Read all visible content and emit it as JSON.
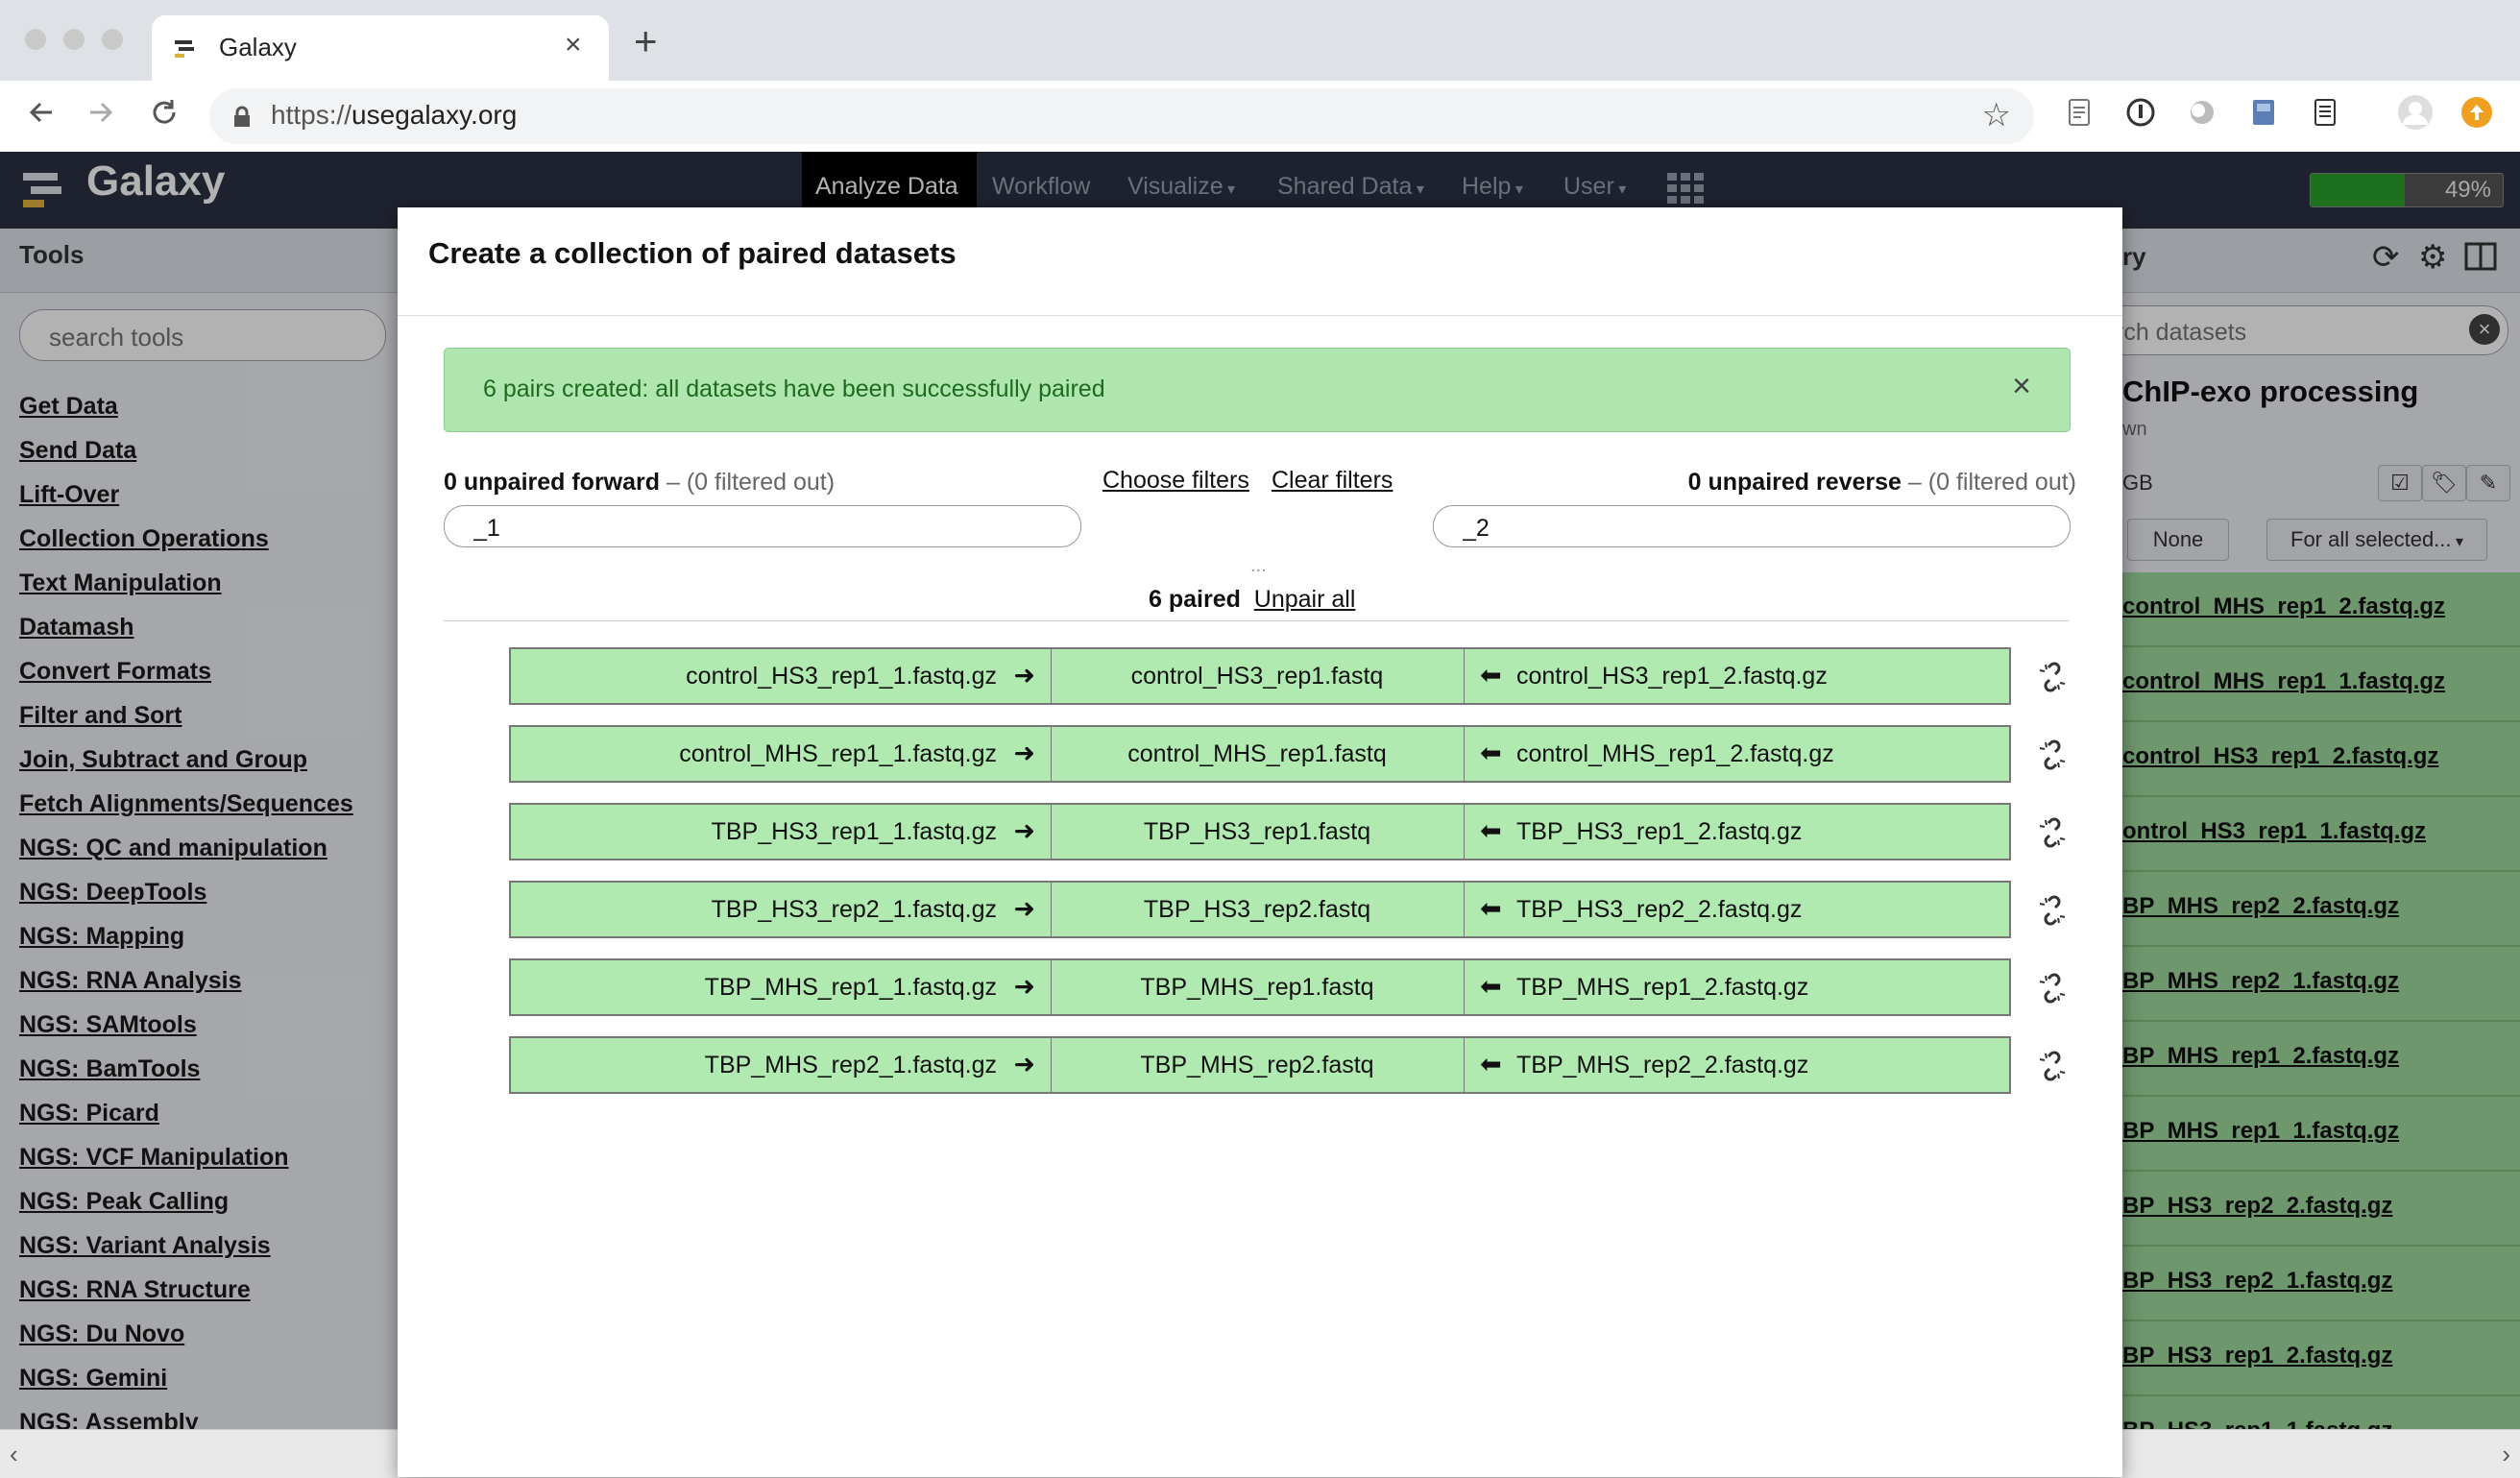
{
  "browser": {
    "tab_title": "Galaxy",
    "tab_close": "×",
    "new_tab": "+",
    "url_scheme": "https://",
    "url_host": "usegalaxy.org",
    "icons": [
      "back-icon",
      "forward-icon",
      "reload-icon",
      "lock-icon",
      "star-icon",
      "extension-icon",
      "profile-icon",
      "update-icon"
    ]
  },
  "masthead": {
    "brand": "Galaxy",
    "nav": [
      "Analyze Data",
      "Workflow",
      "Visualize",
      "Shared Data",
      "Help",
      "User"
    ],
    "active": "Analyze Data",
    "usage_label": "49%",
    "usage_fraction": 0.49
  },
  "tools": {
    "title": "Tools",
    "search_placeholder": "search tools",
    "sections": [
      "Get Data",
      "Send Data",
      "Lift-Over",
      "Collection Operations",
      "Text Manipulation",
      "Datamash",
      "Convert Formats",
      "Filter and Sort",
      "Join, Subtract and Group",
      "Fetch Alignments/Sequences",
      "NGS: QC and manipulation",
      "NGS: DeepTools",
      "NGS: Mapping",
      "NGS: RNA Analysis",
      "NGS: SAMtools",
      "NGS: BamTools",
      "NGS: Picard",
      "NGS: VCF Manipulation",
      "NGS: Peak Calling",
      "NGS: Variant Analysis",
      "NGS: RNA Structure",
      "NGS: Du Novo",
      "NGS: Gemini",
      "NGS: Assembly"
    ]
  },
  "history": {
    "title": "ry",
    "search_placeholder": "rch datasets",
    "name": "ChIP-exo processing",
    "sub": "wn",
    "size": "GB",
    "none_btn": "None",
    "for_all_btn": "For all selected...",
    "datasets": [
      "control_MHS_rep1_2.fastq.gz",
      "control_MHS_rep1_1.fastq.gz",
      "control_HS3_rep1_2.fastq.gz",
      "ontrol_HS3_rep1_1.fastq.gz",
      "BP_MHS_rep2_2.fastq.gz",
      "BP_MHS_rep2_1.fastq.gz",
      "BP_MHS_rep1_2.fastq.gz",
      "BP_MHS_rep1_1.fastq.gz",
      "BP_HS3_rep2_2.fastq.gz",
      "BP_HS3_rep2_1.fastq.gz",
      "BP_HS3_rep1_2.fastq.gz",
      "BP_HS3_rep1_1.fastq.gz"
    ]
  },
  "modal": {
    "title": "Create a collection of paired datasets",
    "alert": "6 pairs created: all datasets have been successfully paired",
    "alert_close": "×",
    "forward": {
      "count_label": "0 unpaired forward",
      "filtered": " – (0 filtered out)",
      "filter_value": "_1"
    },
    "reverse": {
      "count_label": "0 unpaired reverse",
      "filtered": " – (0 filtered out)",
      "filter_value": "_2"
    },
    "choose_filters": "Choose filters",
    "clear_filters": "Clear filters",
    "dots": "...",
    "paired_label": "6 paired",
    "unpair_all": "Unpair all",
    "pairs": [
      {
        "forward": "control_HS3_rep1_1.fastq.gz",
        "name": "control_HS3_rep1.fastq",
        "reverse": "control_HS3_rep1_2.fastq.gz"
      },
      {
        "forward": "control_MHS_rep1_1.fastq.gz",
        "name": "control_MHS_rep1.fastq",
        "reverse": "control_MHS_rep1_2.fastq.gz"
      },
      {
        "forward": "TBP_HS3_rep1_1.fastq.gz",
        "name": "TBP_HS3_rep1.fastq",
        "reverse": "TBP_HS3_rep1_2.fastq.gz"
      },
      {
        "forward": "TBP_HS3_rep2_1.fastq.gz",
        "name": "TBP_HS3_rep2.fastq",
        "reverse": "TBP_HS3_rep2_2.fastq.gz"
      },
      {
        "forward": "TBP_MHS_rep1_1.fastq.gz",
        "name": "TBP_MHS_rep1.fastq",
        "reverse": "TBP_MHS_rep1_2.fastq.gz"
      },
      {
        "forward": "TBP_MHS_rep2_1.fastq.gz",
        "name": "TBP_MHS_rep2.fastq",
        "reverse": "TBP_MHS_rep2_2.fastq.gz"
      }
    ]
  },
  "colors": {
    "masthead": "#2c3143",
    "pair_green": "#b1eab1",
    "alert_green": "#afe6b0",
    "dataset_ok": "#9ed89e"
  }
}
